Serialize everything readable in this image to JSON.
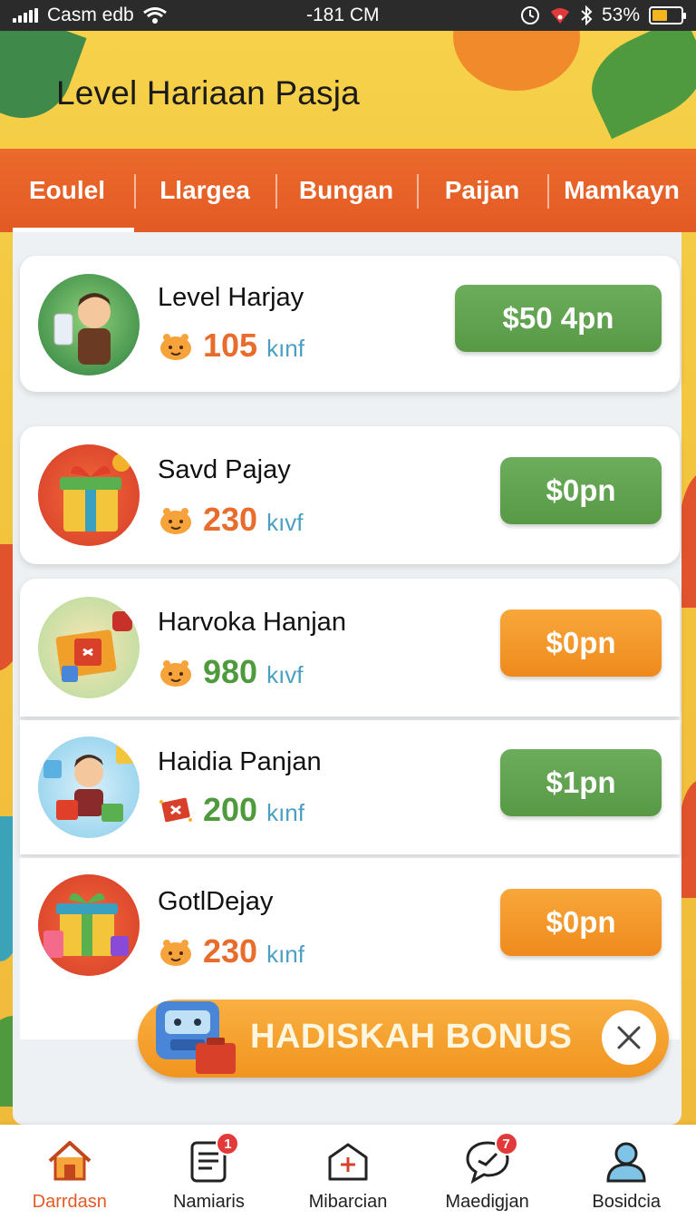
{
  "status_bar": {
    "carrier": "Casm edb",
    "time": "-181 CM",
    "battery": "53%",
    "battery_level": 0.53
  },
  "header": {
    "title": "Level Hariaan Pasja"
  },
  "tabs": [
    {
      "label": "Eoulel",
      "active": true
    },
    {
      "label": "Llargea",
      "active": false
    },
    {
      "label": "Bungan",
      "active": false
    },
    {
      "label": "Paijan",
      "active": false
    },
    {
      "label": "Mamkayn",
      "active": false
    }
  ],
  "rewards": [
    {
      "title": "Level Harjay",
      "amount": "105",
      "unit": "kınf",
      "amount_color": "orange",
      "button": "$50 4pn",
      "button_color": "green",
      "icon": "boy-with-drink-avatar"
    },
    {
      "title": "Savd Pajay",
      "amount": "230",
      "unit": "kıvf",
      "amount_color": "orange",
      "button": "$0pn",
      "button_color": "green",
      "icon": "gift-box-avatar"
    },
    {
      "title": "Harvoka Hanjan",
      "amount": "980",
      "unit": "kıvf",
      "amount_color": "green",
      "button": "$0pn",
      "button_color": "orange",
      "icon": "gift-package-avatar"
    },
    {
      "title": "Haidia Panjan",
      "amount": "200",
      "unit": "kınf",
      "amount_color": "green",
      "button": "$1pn",
      "button_color": "green",
      "icon": "boy-with-gifts-avatar"
    },
    {
      "title": "GotlDejay",
      "amount": "230",
      "unit": "kınf",
      "amount_color": "orange",
      "button": "$0pn",
      "button_color": "orange",
      "icon": "gift-stack-avatar"
    }
  ],
  "bonus": {
    "label": "HADISKAH BONUS",
    "icon": "robot-icon"
  },
  "bottom_nav": [
    {
      "label": "Darrdasn",
      "icon": "home-icon",
      "active": true,
      "badge": ""
    },
    {
      "label": "Namiaris",
      "icon": "document-icon",
      "active": false,
      "badge": "1"
    },
    {
      "label": "Mibarcian",
      "icon": "store-icon",
      "active": false,
      "badge": ""
    },
    {
      "label": "Maedigjan",
      "icon": "chat-icon",
      "active": false,
      "badge": "7"
    },
    {
      "label": "Bosidcia",
      "icon": "profile-icon",
      "active": false,
      "badge": ""
    }
  ],
  "colors": {
    "accent_orange": "#e25a24",
    "button_green": "#589946",
    "button_orange": "#ef8a1d",
    "background_yellow": "#f3c43e"
  }
}
